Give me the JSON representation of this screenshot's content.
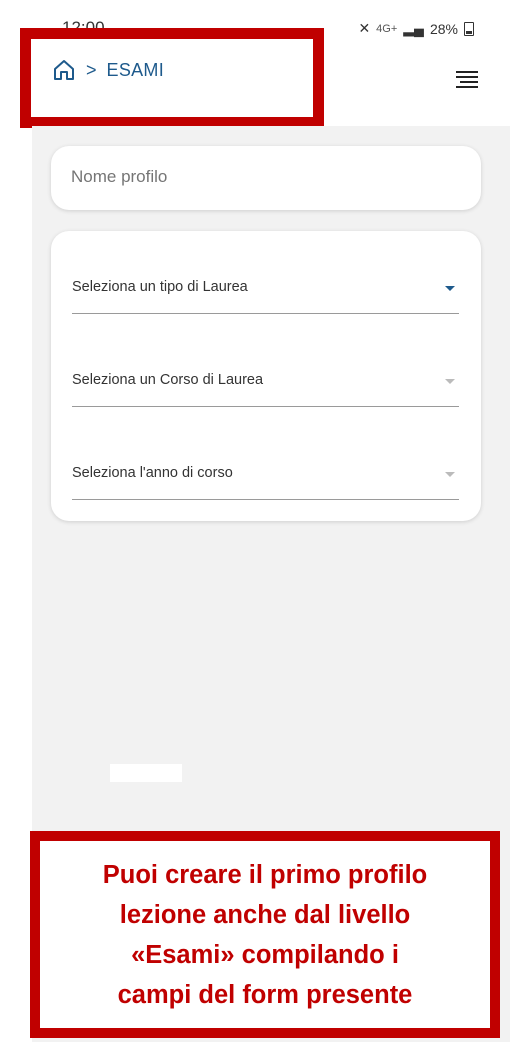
{
  "status_bar": {
    "time": "12:00",
    "signal": "4G+",
    "battery": "28%"
  },
  "header": {
    "breadcrumb_label": "ESAMI",
    "breadcrumb_separator": ">"
  },
  "profile": {
    "placeholder": "Nome profilo"
  },
  "selects": [
    {
      "label": "Seleziona un tipo di Laurea"
    },
    {
      "label": "Seleziona un Corso di Laurea"
    },
    {
      "label": "Seleziona l'anno di corso"
    }
  ],
  "callout": {
    "lines": [
      "Puoi creare il primo profilo",
      "lezione anche dal livello",
      "«Esami» compilando i",
      "campi del form presente"
    ]
  },
  "colors": {
    "brand": "#1e5a8c",
    "highlight": "#c00000",
    "background": "#f2f2f2"
  }
}
